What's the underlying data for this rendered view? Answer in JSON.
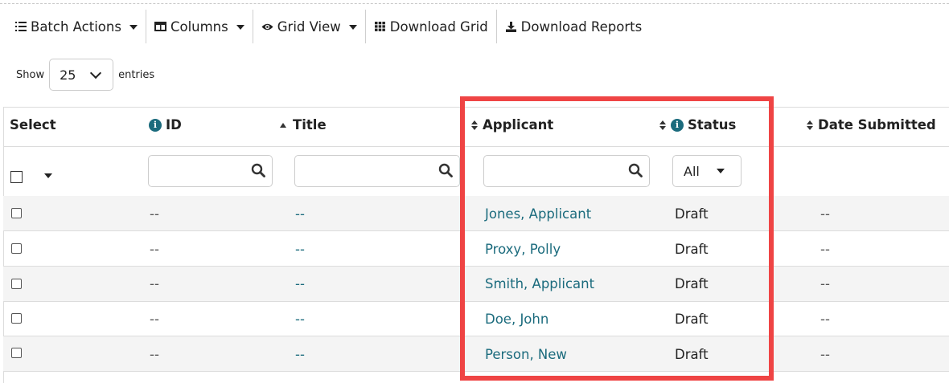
{
  "toolbar": {
    "batch_actions": "Batch Actions",
    "columns": "Columns",
    "grid_view": "Grid View",
    "download_grid": "Download Grid",
    "download_reports": "Download Reports"
  },
  "entries": {
    "show": "Show",
    "value": "25",
    "suffix": "entries"
  },
  "table": {
    "headers": {
      "select": "Select",
      "id": "ID",
      "title": "Title",
      "applicant": "Applicant",
      "status": "Status",
      "date_submitted": "Date Submitted"
    },
    "status_filter": "All",
    "rows": [
      {
        "id": "--",
        "title": "--",
        "applicant": "Jones, Applicant",
        "status": "Draft",
        "date": "--"
      },
      {
        "id": "--",
        "title": "--",
        "applicant": "Proxy, Polly",
        "status": "Draft",
        "date": "--"
      },
      {
        "id": "--",
        "title": "--",
        "applicant": "Smith, Applicant",
        "status": "Draft",
        "date": "--"
      },
      {
        "id": "--",
        "title": "--",
        "applicant": "Doe, John",
        "status": "Draft",
        "date": "--"
      },
      {
        "id": "--",
        "title": "--",
        "applicant": "Person, New",
        "status": "Draft",
        "date": "--"
      }
    ]
  },
  "colors": {
    "link": "#1b6b7d",
    "highlight": "#ef4444",
    "stripe": "#f4f4f4"
  },
  "icons": [
    "list-icon",
    "columns-icon",
    "eye-icon",
    "grid-icon",
    "download-icon",
    "info-icon",
    "search-icon",
    "sort-icon"
  ]
}
